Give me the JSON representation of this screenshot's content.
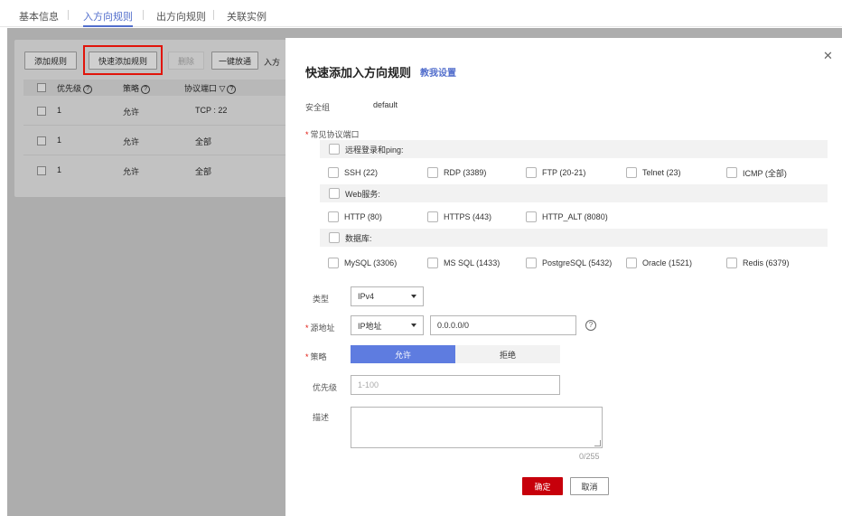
{
  "tabs": [
    {
      "label": "基本信息"
    },
    {
      "label": "入方向规则"
    },
    {
      "label": "出方向规则"
    },
    {
      "label": "关联实例"
    }
  ],
  "toolbar": {
    "add_rule": "添加规则",
    "quick_add": "快速添加规则",
    "delete": "删除",
    "allow_all": "一键放通",
    "more_truncated": "入方"
  },
  "table": {
    "headers": {
      "priority": "优先级",
      "policy": "策略",
      "protocol_port": "协议端口"
    },
    "rows": [
      {
        "priority": "1",
        "policy": "允许",
        "protocol_port": "TCP : 22"
      },
      {
        "priority": "1",
        "policy": "允许",
        "protocol_port": "全部"
      },
      {
        "priority": "1",
        "policy": "允许",
        "protocol_port": "全部"
      }
    ]
  },
  "drawer": {
    "title": "快速添加入方向规则",
    "help_link": "教我设置",
    "security_group_label": "安全组",
    "security_group_value": "default",
    "common_ports_label": "常见协议端口",
    "groups": {
      "remote": {
        "label": "远程登录和ping:",
        "options": [
          "SSH (22)",
          "RDP (3389)",
          "FTP (20-21)",
          "Telnet (23)",
          "ICMP (全部)"
        ]
      },
      "web": {
        "label": "Web服务:",
        "options": [
          "HTTP (80)",
          "HTTPS (443)",
          "HTTP_ALT (8080)"
        ]
      },
      "db": {
        "label": "数据库:",
        "options": [
          "MySQL (3306)",
          "MS SQL (1433)",
          "PostgreSQL (5432)",
          "Oracle (1521)",
          "Redis (6379)"
        ]
      }
    },
    "type_label": "类型",
    "type_value": "IPv4",
    "source_label": "源地址",
    "source_type": "IP地址",
    "source_value": "0.0.0.0/0",
    "policy_label": "策略",
    "policy_allow": "允许",
    "policy_deny": "拒绝",
    "priority_label": "优先级",
    "priority_placeholder": "1-100",
    "desc_label": "描述",
    "desc_counter": "0/255",
    "confirm": "确定",
    "cancel": "取消"
  },
  "colors": {
    "accent": "#526ecc",
    "segment_on": "#5e7ce0",
    "primary_button": "#c7000b",
    "highlight": "#e1140a"
  }
}
